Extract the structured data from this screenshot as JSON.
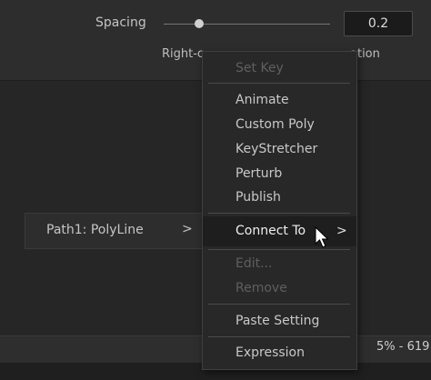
{
  "inspector": {
    "spacing_label": "Spacing",
    "spacing_value": "0.2",
    "spacing_slider_fraction": 0.19,
    "right_label_partial": "Right-c",
    "orientation_tail": "ation"
  },
  "submenu": {
    "item_label": "Path1: PolyLine",
    "arrow": ">"
  },
  "context_menu": {
    "items": [
      {
        "label": "Set Key",
        "disabled": true
      },
      {
        "label": "Animate",
        "disabled": false
      },
      {
        "label": "Custom Poly",
        "disabled": false
      },
      {
        "label": "KeyStretcher",
        "disabled": false
      },
      {
        "label": "Perturb",
        "disabled": false
      },
      {
        "label": "Publish",
        "disabled": false
      },
      {
        "label": "Connect To",
        "disabled": false,
        "highlight": true,
        "arrow": ">"
      },
      {
        "label": "Edit...",
        "disabled": true
      },
      {
        "label": "Remove",
        "disabled": true
      },
      {
        "label": "Paste Setting",
        "disabled": false
      },
      {
        "label": "Expression",
        "disabled": false
      }
    ]
  },
  "range_text": "5% - 619",
  "colors": {
    "background": "#262626",
    "menu_bg": "#282828",
    "highlight": "#1e1e1e",
    "disabled_text": "#5f5f5f"
  }
}
